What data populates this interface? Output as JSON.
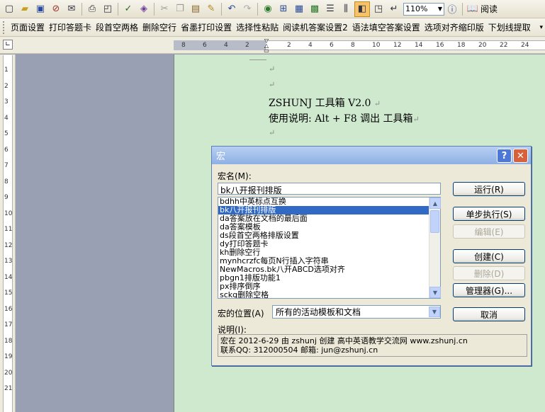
{
  "toolbar": {
    "zoom": "110%",
    "read_label": "阅读",
    "icons": [
      "new-icon",
      "open-icon",
      "save-icon",
      "permission-icon",
      "email-icon",
      "print-icon",
      "print-preview-icon",
      "spellcheck-icon",
      "research-icon",
      "cut-icon",
      "copy-icon",
      "paste-icon",
      "format-painter-icon",
      "undo-icon",
      "redo-icon",
      "hyperlink-icon",
      "tables-borders-icon",
      "insert-table-icon",
      "insert-excel-icon",
      "columns-icon",
      "drawing-icon",
      "document-map-icon",
      "show-hide-icon",
      "help-icon"
    ]
  },
  "macro_toolbar": {
    "items": [
      "页面设置",
      "打印答题卡",
      "段首空两格",
      "删除空行",
      "省墨打印设置",
      "选择性粘贴",
      "阅读机答案设置2",
      "语法填空答案设置",
      "选项对齐缩印版",
      "下划线提取"
    ]
  },
  "ruler": {
    "left_labels": [
      "8",
      "6",
      "4",
      "2"
    ],
    "right_labels": [
      "2",
      "4",
      "6",
      "8",
      "10",
      "12",
      "14",
      "16",
      "18",
      "20",
      "22",
      "24"
    ],
    "vertical_labels": [
      "1",
      "2",
      "3",
      "4",
      "5",
      "6",
      "7",
      "8",
      "9",
      "10",
      "11",
      "12",
      "13",
      "14",
      "15",
      "16",
      "17",
      "18",
      "19",
      "20",
      "21"
    ]
  },
  "document": {
    "line1": "ZSHUNJ 工具箱 V2.0",
    "line2": "使用说明: Alt + F8 调出  工具箱",
    "para_mark": "↵"
  },
  "dialog": {
    "title": "宏",
    "help_btn": "?",
    "close_btn": "✕",
    "macro_name_label": "宏名(M):",
    "macro_name_value": "bk八开报刊排版",
    "macros": [
      "bdhh中英标点互换",
      "bk八开报刊排版",
      "da答案放在文档的最后面",
      "da答案模板",
      "ds段首空两格排版设置",
      "dy打印答题卡",
      "kh删除空行",
      "mynhcrzfc每页N行插入字符串",
      "NewMacros.bk八开ABCD选项对齐",
      "pbgn1排版功能1",
      "px排序倒序",
      "sckg删除空格"
    ],
    "selected_index": 1,
    "location_label": "宏的位置(A)",
    "location_value": "所有的活动模板和文档",
    "description_label": "说明(I):",
    "description_lines": [
      "宏在 2012-6-29 由 zshunj 创建 高中英语教学交流网 www.zshunj.cn",
      "联系QQ: 312000504  邮箱: jun@zshunj.cn"
    ],
    "buttons": {
      "run": "运行(R)",
      "step": "单步执行(S)",
      "edit": "编辑(E)",
      "create": "创建(C)",
      "delete": "删除(D)",
      "organizer": "管理器(G)...",
      "cancel": "取消"
    }
  }
}
